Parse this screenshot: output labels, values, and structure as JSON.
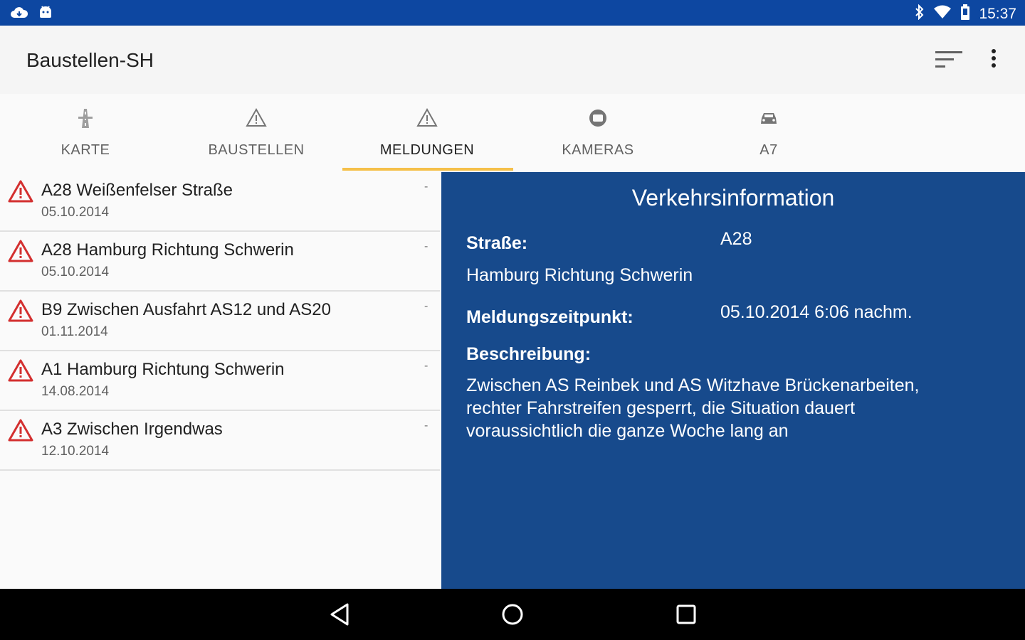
{
  "status_bar": {
    "time": "15:37",
    "left_icons": [
      "cloud-icon",
      "android-icon"
    ],
    "right_icons": [
      "bluetooth-icon",
      "wifi-icon",
      "battery-icon"
    ],
    "color": "#0d47a1"
  },
  "app_bar": {
    "title": "Baustellen-SH",
    "actions": [
      "sort-icon",
      "more-vert-icon"
    ]
  },
  "tabs": [
    {
      "label": "KARTE",
      "icon": "road-icon",
      "active": false
    },
    {
      "label": "BAUSTELLEN",
      "icon": "warning-icon",
      "active": false
    },
    {
      "label": "MELDUNGEN",
      "icon": "warning-icon",
      "active": true
    },
    {
      "label": "KAMERAS",
      "icon": "camera-icon",
      "active": false
    },
    {
      "label": "A7",
      "icon": "car-icon",
      "active": false
    }
  ],
  "tab_indicator_color": "#f5c04a",
  "messages": [
    {
      "title": "A28 Weißenfelser Straße",
      "date": "05.10.2014",
      "trailing": "-"
    },
    {
      "title": "A28 Hamburg Richtung Schwerin",
      "date": "05.10.2014",
      "trailing": "-"
    },
    {
      "title": "B9 Zwischen Ausfahrt AS12 und AS20",
      "date": "01.11.2014",
      "trailing": "-"
    },
    {
      "title": "A1 Hamburg Richtung Schwerin",
      "date": "14.08.2014",
      "trailing": "-"
    },
    {
      "title": "A3 Zwischen Irgendwas",
      "date": "12.10.2014",
      "trailing": "-"
    }
  ],
  "detail": {
    "heading": "Verkehrsinformation",
    "road_label": "Straße:",
    "road_value": "A28",
    "road_description": "Hamburg Richtung Schwerin",
    "time_label": "Meldungszeitpunkt:",
    "time_value": "05.10.2014 6:06 nachm.",
    "description_label": "Beschreibung:",
    "description_lines": [
      "Zwischen AS Reinbek und AS Witzhave Brückenarbeiten,",
      "rechter Fahrstreifen gesperrt, die Situation dauert",
      "voraussichtlich die ganze Woche lang an"
    ],
    "background": "#174a8c"
  },
  "nav_bar": {
    "buttons": [
      "back-icon",
      "home-icon",
      "recents-icon"
    ]
  }
}
